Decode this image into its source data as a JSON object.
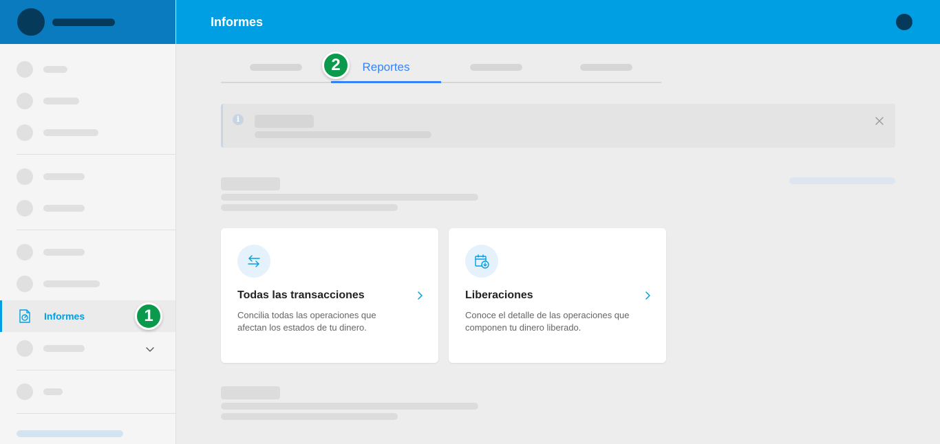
{
  "header": {
    "title": "Informes"
  },
  "sidebar": {
    "active_item_label": "Informes",
    "active_icon": "document-report-icon"
  },
  "tabs": {
    "active_label": "Reportes"
  },
  "badges": {
    "one": "1",
    "two": "2"
  },
  "notice": {
    "info_icon_glyph": "i"
  },
  "cards": [
    {
      "icon": "transfer-arrows-icon",
      "title": "Todas las transacciones",
      "description": "Concilia todas las operaciones que afectan los estados de tu dinero."
    },
    {
      "icon": "calendar-download-icon",
      "title": "Liberaciones",
      "description": "Conoce el detalle de las operaciones que componen tu dinero liberado."
    }
  ],
  "colors": {
    "header_bg": "#009ee3",
    "sidebar_header_bg": "#0a7bbf",
    "accent": "#3483fa",
    "badge_green": "#0b9a4b"
  }
}
